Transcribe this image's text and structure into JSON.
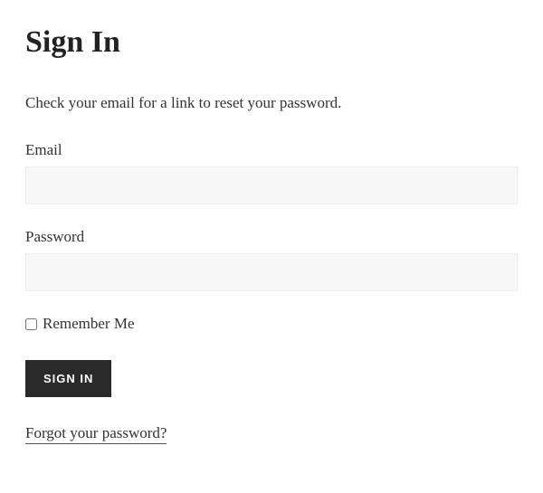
{
  "page": {
    "title": "Sign In"
  },
  "status": {
    "message": "Check your email for a link to reset your password."
  },
  "form": {
    "email": {
      "label": "Email",
      "value": ""
    },
    "password": {
      "label": "Password",
      "value": ""
    },
    "remember": {
      "label": "Remember Me"
    },
    "submit": {
      "label": "SIGN IN"
    },
    "forgot": {
      "label": "Forgot your password?"
    }
  }
}
